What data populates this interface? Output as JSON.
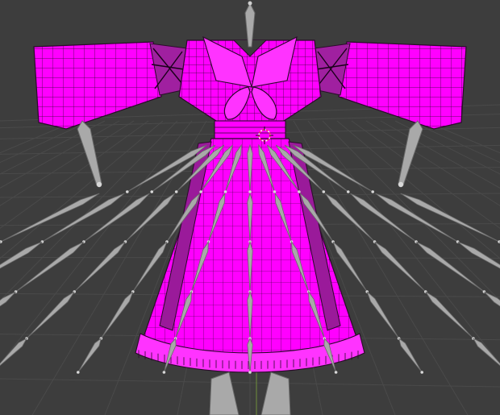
{
  "viewport": {
    "background": "#3d3d3d",
    "grid_color": "#4a4a4a",
    "axis_color": "#6f8f3a"
  },
  "mesh": {
    "name": "dress",
    "fill_color": "#ff00ff",
    "wire_color": "#2a0a2a",
    "selected": true
  },
  "armature": {
    "bone_color": "#a9a9a9",
    "bone_edge": "#6a6a6a"
  },
  "cursor": {
    "name": "3d-cursor",
    "color": "#ff3355"
  }
}
